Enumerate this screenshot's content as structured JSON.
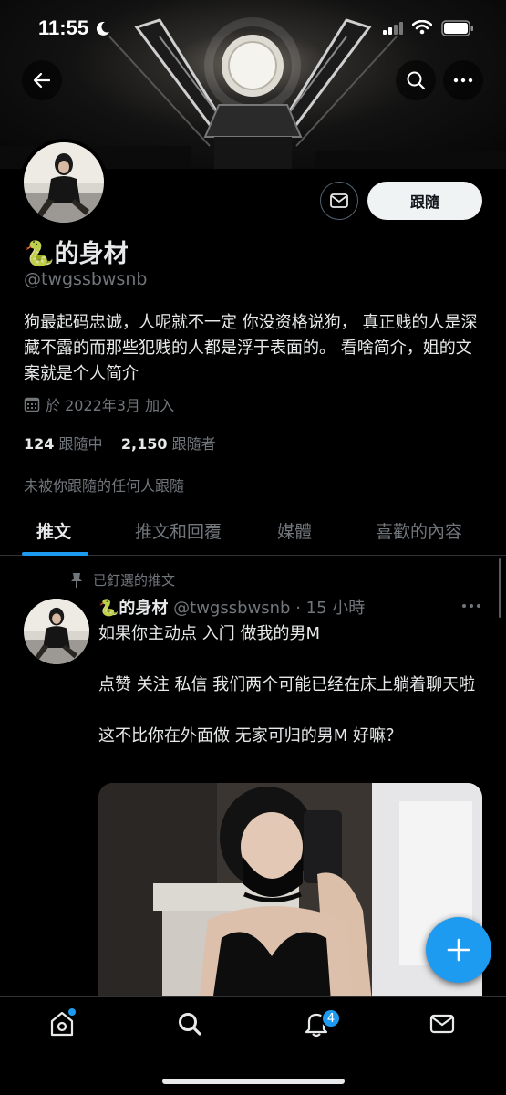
{
  "status_bar": {
    "time": "11:55"
  },
  "profile": {
    "display_name": "🐍的身材",
    "handle": "@twgssbwsnb",
    "follow_label": "跟隨",
    "bio": "狗最起码忠诚，人呢就不一定 你没资格说狗， 真正贱的人是深藏不露的而那些犯贱的人都是浮于表面的。 看啥简介，姐的文案就是个人简介",
    "joined": "於 2022年3月 加入",
    "following_count": "124",
    "following_label": "跟隨中",
    "followers_count": "2,150",
    "followers_label": "跟隨者",
    "followed_by_note": "未被你跟隨的任何人跟隨"
  },
  "tabs": [
    {
      "label": "推文",
      "active": true
    },
    {
      "label": "推文和回覆",
      "active": false
    },
    {
      "label": "媒體",
      "active": false
    },
    {
      "label": "喜歡的內容",
      "active": false
    }
  ],
  "tweet": {
    "pinned_label": "已釘選的推文",
    "author_name": "🐍的身材",
    "author_meta": "@twgssbwsnb · 15 小時",
    "text": "如果你主动点 入门  做我的男M\n\n点赞  关注  私信    我们两个可能已经在床上躺着聊天啦\n\n这不比你在外面做 无家可归的男M 好嘛？"
  },
  "bottom_nav": {
    "notification_count": "4"
  },
  "colors": {
    "accent": "#1d9bf0",
    "secondary_text": "#71767b",
    "primary_text": "#e7e9ea"
  }
}
